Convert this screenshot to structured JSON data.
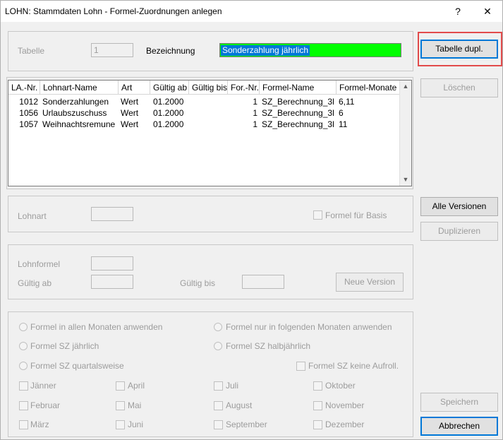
{
  "window": {
    "title": "LOHN: Stammdaten Lohn - Formel-Zuordnungen anlegen",
    "help_glyph": "?",
    "close_glyph": "✕"
  },
  "top": {
    "tabelle_label": "Tabelle",
    "tabelle_value": "1",
    "bezeichnung_label": "Bezeichnung",
    "bezeichnung_value": "Sonderzahlung jährlich",
    "bezeichnung_bg": "#00ff00"
  },
  "table": {
    "headers": [
      "LA.-Nr.",
      "Lohnart-Name",
      "Art",
      "Gültig ab",
      "Gültig bis",
      "For.-Nr.",
      "Formel-Name",
      "Formel-Monate"
    ],
    "rows": [
      [
        "1012",
        "Sonderzahlungen",
        "Wert",
        "01.2000",
        "",
        "1",
        "SZ_Berechnung_3l",
        "6,11"
      ],
      [
        "1056",
        "Urlaubszuschuss",
        "Wert",
        "01.2000",
        "",
        "1",
        "SZ_Berechnung_3l",
        "6"
      ],
      [
        "1057",
        "Weihnachtsremune",
        "Wert",
        "01.2000",
        "",
        "1",
        "SZ_Berechnung_3l",
        "11"
      ]
    ]
  },
  "lohnart": {
    "label": "Lohnart",
    "formel_basis_label": "Formel für Basis"
  },
  "formel": {
    "lohnformel_label": "Lohnformel",
    "gueltig_ab_label": "Gültig ab",
    "gueltig_bis_label": "Gültig bis",
    "neue_version_label": "Neue Version"
  },
  "options": {
    "radio_all_months": "Formel in allen Monaten anwenden",
    "radio_following_months": "Formel nur in folgenden Monaten anwenden",
    "radio_sz_jaehrlich": "Formel SZ jährlich",
    "radio_sz_halbjaehrlich": "Formel SZ halbjährlich",
    "radio_sz_quartalsweise": "Formel SZ quartalsweise",
    "check_keine_aufroll": "Formel SZ keine Aufroll.",
    "months": [
      "Jänner",
      "Februar",
      "März",
      "April",
      "Mai",
      "Juni",
      "Juli",
      "August",
      "September",
      "Oktober",
      "November",
      "Dezember"
    ]
  },
  "buttons": {
    "tabelle_dupl": "Tabelle dupl.",
    "loeschen": "Löschen",
    "alle_versionen": "Alle Versionen",
    "duplizieren": "Duplizieren",
    "speichern": "Speichern",
    "abbrechen": "Abbrechen"
  },
  "colors": {
    "highlight": "#e24b4b",
    "selection": "#0078d7",
    "disabled_text": "#9c9c9c"
  }
}
